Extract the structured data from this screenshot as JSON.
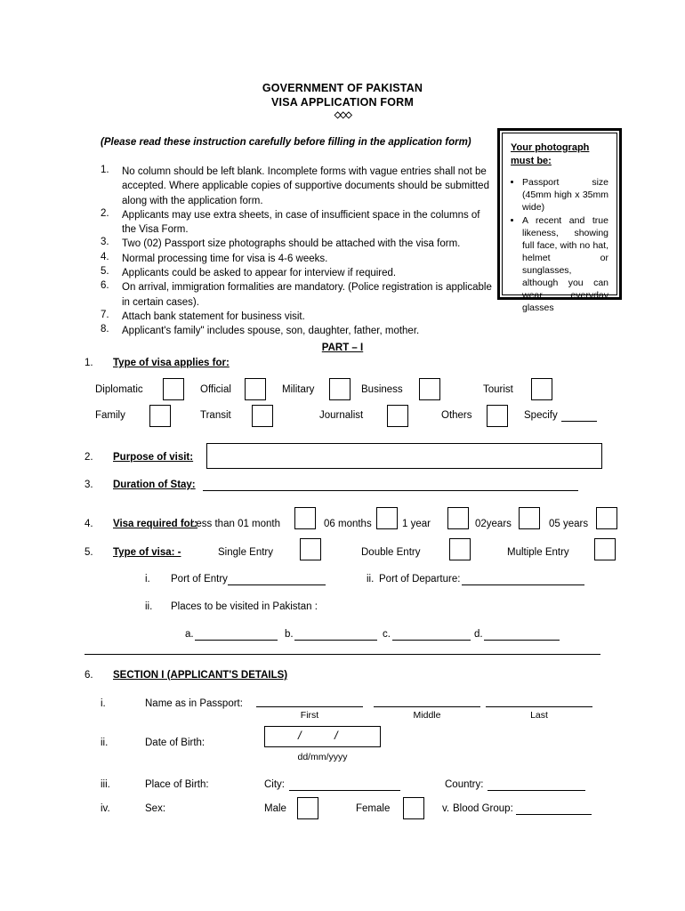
{
  "header": {
    "line1": "GOVERNMENT OF PAKISTAN",
    "line2": "VISA APPLICATION FORM",
    "decoration": "◇◇◇",
    "instruction_heading": "(Please read these instruction carefully before filling in the application form)"
  },
  "instructions": [
    {
      "num": "1.",
      "text": "No column should be left blank. Incomplete forms with vague entries shall not be accepted. Where applicable copies of supportive documents should be submitted along with the application form."
    },
    {
      "num": "2.",
      "text": "Applicants may use extra sheets, in case of insufficient space in the columns of the Visa Form."
    },
    {
      "num": "3.",
      "text": "Two (02) Passport size photographs should be attached with the visa form."
    },
    {
      "num": "4.",
      "text": "Normal processing time for visa is 4-6 weeks."
    },
    {
      "num": "5.",
      "text": "Applicants could be asked to appear for interview if required."
    },
    {
      "num": "6.",
      "text": "On arrival, immigration formalities are mandatory. (Police registration is applicable in certain cases)."
    },
    {
      "num": "7.",
      "text": "Attach bank statement for business visit."
    },
    {
      "num": "8.",
      "text": "Applicant's family\" includes spouse, son, daughter, father, mother."
    }
  ],
  "photo_box": {
    "title": "Your photograph must be:",
    "bullets": [
      "Passport size (45mm high x 35mm wide)",
      "A recent and true likeness, showing full face, with no hat, helmet or sunglasses, although you can wear everyday glasses"
    ]
  },
  "part1": {
    "heading": "PART – I",
    "q1": {
      "num": "1.",
      "label": "Type of visa applies for:",
      "row1": [
        {
          "label": "Diplomatic"
        },
        {
          "label": "Official"
        },
        {
          "label": "Military"
        },
        {
          "label": "Business"
        },
        {
          "label": "Tourist"
        }
      ],
      "row2": [
        {
          "label": "Family"
        },
        {
          "label": "Transit"
        },
        {
          "label": "Journalist"
        },
        {
          "label": "Others"
        }
      ],
      "specify_label": "Specify"
    },
    "q2": {
      "num": "2.",
      "label": "Purpose of visit:",
      "value": ""
    },
    "q3": {
      "num": "3.",
      "label": "Duration of Stay:",
      "value": ""
    },
    "q4": {
      "num": "4.",
      "label": "Visa required for:",
      "options": [
        {
          "label": "Less than 01 month"
        },
        {
          "label": "06 months"
        },
        {
          "label": "1 year"
        },
        {
          "label": "02years"
        },
        {
          "label": "05 years"
        }
      ]
    },
    "q5": {
      "num": "5.",
      "label": "Type of visa: -",
      "options": [
        {
          "label": "Single Entry"
        },
        {
          "label": "Double Entry"
        },
        {
          "label": "Multiple Entry"
        }
      ]
    },
    "sub_i": {
      "num": "i.",
      "port_entry_label": "Port of Entry",
      "port_entry_value": "",
      "port_departure_num": "ii.",
      "port_departure_label": "Port of Departure:",
      "port_departure_value": ""
    },
    "sub_ii": {
      "num": "ii.",
      "label": "Places to be visited in Pakistan :",
      "places": [
        {
          "letter": "a.",
          "value": ""
        },
        {
          "letter": "b.",
          "value": ""
        },
        {
          "letter": "c.",
          "value": ""
        },
        {
          "letter": "d.",
          "value": ""
        }
      ]
    }
  },
  "section1": {
    "num": "6.",
    "heading": "SECTION I (APPLICANT'S DETAILS)",
    "name": {
      "num": "i.",
      "label": "Name as in Passport:",
      "first_label": "First",
      "middle_label": "Middle",
      "last_label": "Last",
      "first_value": "",
      "middle_value": "",
      "last_value": ""
    },
    "dob": {
      "num": "ii.",
      "label": "Date of Birth:",
      "separator": "/",
      "hint": "dd/mm/yyyy",
      "day": "",
      "month": "",
      "year": ""
    },
    "pob": {
      "num": "iii.",
      "label": "Place of Birth:",
      "city_label": "City:",
      "city_value": "",
      "country_label": "Country:",
      "country_value": ""
    },
    "sex": {
      "num": "iv.",
      "label": "Sex:",
      "male_label": "Male",
      "female_label": "Female",
      "blood_num": "v.",
      "blood_label": "Blood Group:",
      "blood_value": ""
    }
  }
}
